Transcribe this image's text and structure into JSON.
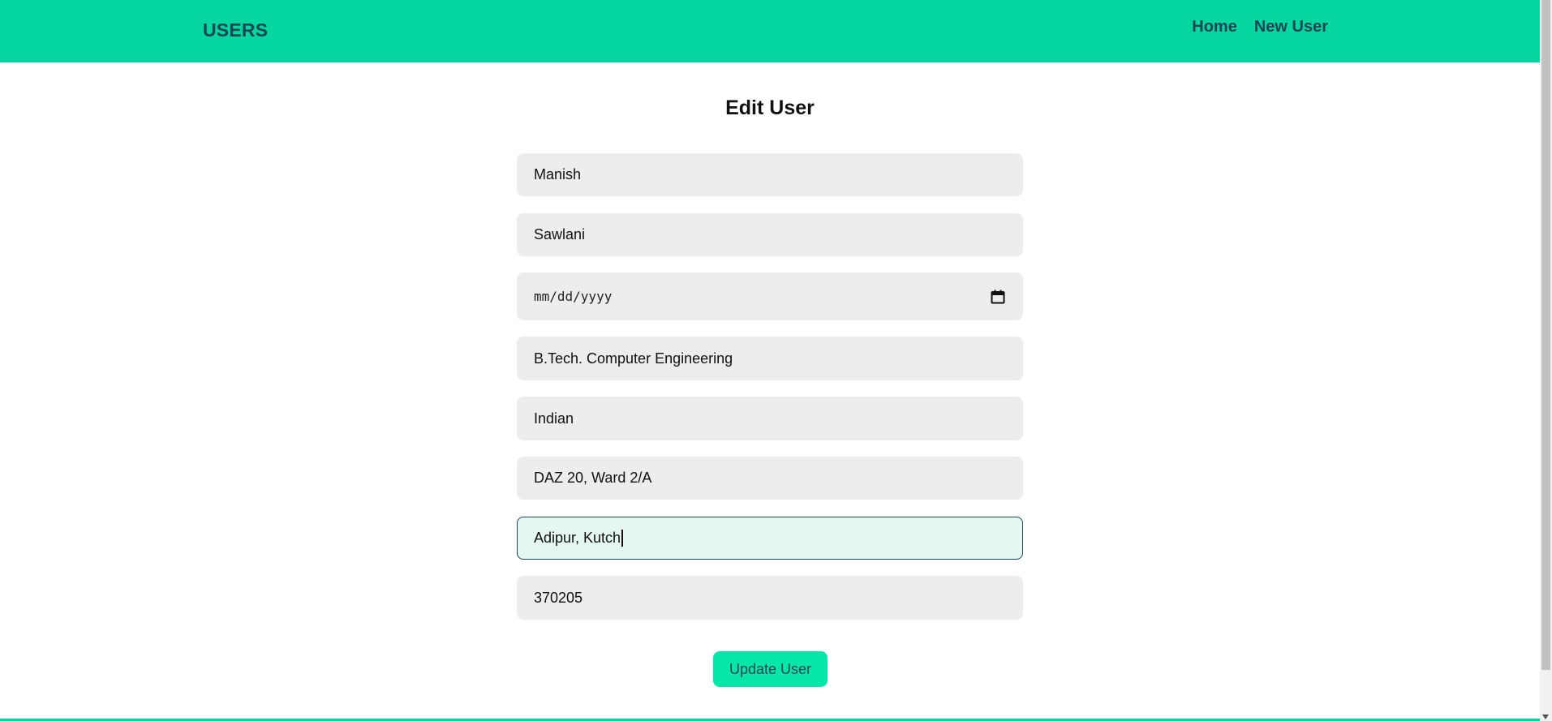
{
  "header": {
    "brand": "USERS",
    "nav": [
      {
        "label": "Home"
      },
      {
        "label": "New User"
      }
    ]
  },
  "form": {
    "title": "Edit User",
    "fields": [
      {
        "name": "first-name",
        "value": "Manish"
      },
      {
        "name": "last-name",
        "value": "Sawlani"
      },
      {
        "name": "date-of-birth",
        "value": "mm/dd/yyyy"
      },
      {
        "name": "education",
        "value": "B.Tech. Computer Engineering"
      },
      {
        "name": "nationality",
        "value": "Indian"
      },
      {
        "name": "address",
        "value": "DAZ 20, Ward 2/A"
      },
      {
        "name": "city",
        "value": "Adipur, Kutch"
      },
      {
        "name": "pincode",
        "value": "370205"
      }
    ],
    "submit_label": "Update User"
  },
  "colors": {
    "accent": "#06d6a0",
    "button": "#06e6a8",
    "nav_text": "#1d4654",
    "field_bg": "#ededed",
    "focus_bg": "#e4f7f1"
  },
  "icons": {
    "date_picker": "calendar-icon"
  }
}
